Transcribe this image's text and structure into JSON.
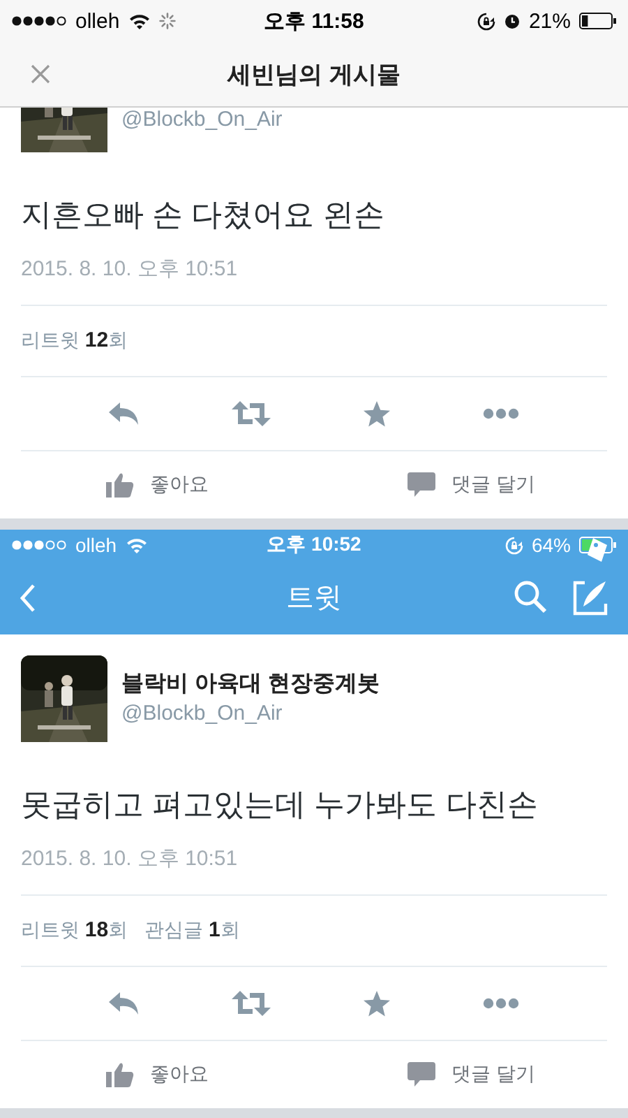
{
  "status_bar": {
    "carrier": "olleh",
    "time": "오후 11:58",
    "battery": "21%"
  },
  "header": {
    "title": "세빈님의 게시물"
  },
  "posts": [
    {
      "tweet": {
        "handle": "@Blockb_On_Air",
        "text": "지흔오빠 손 다쳤어요 왼손",
        "date": "2015. 8. 10. 오후 10:51",
        "stats": [
          "리트윗 **12**회"
        ]
      },
      "actions": [
        "좋아요",
        "댓글 달기"
      ]
    },
    {
      "screen": {
        "status_bar": {
          "carrier": "olleh",
          "time": "오후 10:52",
          "battery": "64%"
        },
        "title": "트윗"
      },
      "tweet": {
        "name": "블락비 아육대 현장중계봇",
        "handle": "@Blockb_On_Air",
        "text": "못굽히고 펴고있는데 누가봐도 다친손",
        "date": "2015. 8. 10. 오후 10:51",
        "stats": [
          "리트윗 **18**회",
          "관심글 **1**회"
        ]
      },
      "actions": [
        "좋아요",
        "댓글 달기"
      ]
    }
  ]
}
